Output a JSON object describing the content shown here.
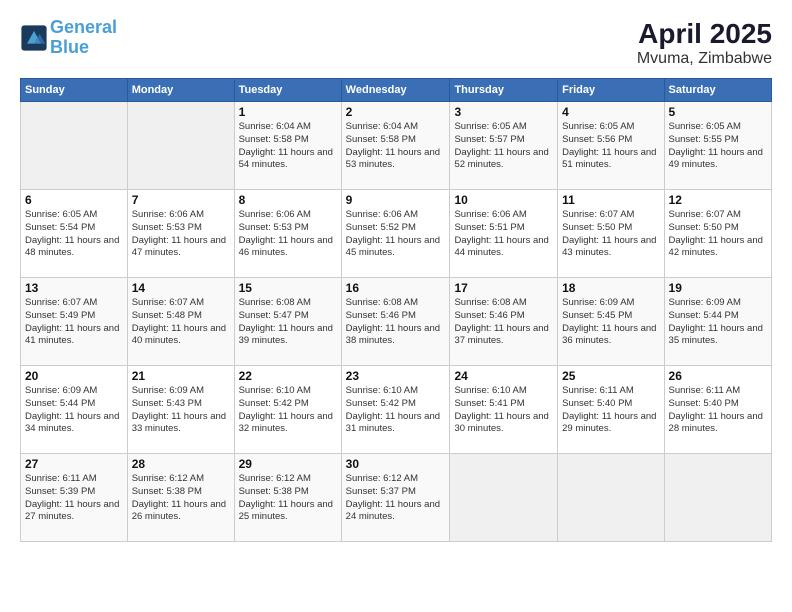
{
  "header": {
    "logo_line1": "General",
    "logo_line2": "Blue",
    "title": "April 2025",
    "subtitle": "Mvuma, Zimbabwe"
  },
  "weekdays": [
    "Sunday",
    "Monday",
    "Tuesday",
    "Wednesday",
    "Thursday",
    "Friday",
    "Saturday"
  ],
  "weeks": [
    [
      {
        "day": null,
        "sunrise": null,
        "sunset": null,
        "daylight": null
      },
      {
        "day": null,
        "sunrise": null,
        "sunset": null,
        "daylight": null
      },
      {
        "day": "1",
        "sunrise": "Sunrise: 6:04 AM",
        "sunset": "Sunset: 5:58 PM",
        "daylight": "Daylight: 11 hours and 54 minutes."
      },
      {
        "day": "2",
        "sunrise": "Sunrise: 6:04 AM",
        "sunset": "Sunset: 5:58 PM",
        "daylight": "Daylight: 11 hours and 53 minutes."
      },
      {
        "day": "3",
        "sunrise": "Sunrise: 6:05 AM",
        "sunset": "Sunset: 5:57 PM",
        "daylight": "Daylight: 11 hours and 52 minutes."
      },
      {
        "day": "4",
        "sunrise": "Sunrise: 6:05 AM",
        "sunset": "Sunset: 5:56 PM",
        "daylight": "Daylight: 11 hours and 51 minutes."
      },
      {
        "day": "5",
        "sunrise": "Sunrise: 6:05 AM",
        "sunset": "Sunset: 5:55 PM",
        "daylight": "Daylight: 11 hours and 49 minutes."
      }
    ],
    [
      {
        "day": "6",
        "sunrise": "Sunrise: 6:05 AM",
        "sunset": "Sunset: 5:54 PM",
        "daylight": "Daylight: 11 hours and 48 minutes."
      },
      {
        "day": "7",
        "sunrise": "Sunrise: 6:06 AM",
        "sunset": "Sunset: 5:53 PM",
        "daylight": "Daylight: 11 hours and 47 minutes."
      },
      {
        "day": "8",
        "sunrise": "Sunrise: 6:06 AM",
        "sunset": "Sunset: 5:53 PM",
        "daylight": "Daylight: 11 hours and 46 minutes."
      },
      {
        "day": "9",
        "sunrise": "Sunrise: 6:06 AM",
        "sunset": "Sunset: 5:52 PM",
        "daylight": "Daylight: 11 hours and 45 minutes."
      },
      {
        "day": "10",
        "sunrise": "Sunrise: 6:06 AM",
        "sunset": "Sunset: 5:51 PM",
        "daylight": "Daylight: 11 hours and 44 minutes."
      },
      {
        "day": "11",
        "sunrise": "Sunrise: 6:07 AM",
        "sunset": "Sunset: 5:50 PM",
        "daylight": "Daylight: 11 hours and 43 minutes."
      },
      {
        "day": "12",
        "sunrise": "Sunrise: 6:07 AM",
        "sunset": "Sunset: 5:50 PM",
        "daylight": "Daylight: 11 hours and 42 minutes."
      }
    ],
    [
      {
        "day": "13",
        "sunrise": "Sunrise: 6:07 AM",
        "sunset": "Sunset: 5:49 PM",
        "daylight": "Daylight: 11 hours and 41 minutes."
      },
      {
        "day": "14",
        "sunrise": "Sunrise: 6:07 AM",
        "sunset": "Sunset: 5:48 PM",
        "daylight": "Daylight: 11 hours and 40 minutes."
      },
      {
        "day": "15",
        "sunrise": "Sunrise: 6:08 AM",
        "sunset": "Sunset: 5:47 PM",
        "daylight": "Daylight: 11 hours and 39 minutes."
      },
      {
        "day": "16",
        "sunrise": "Sunrise: 6:08 AM",
        "sunset": "Sunset: 5:46 PM",
        "daylight": "Daylight: 11 hours and 38 minutes."
      },
      {
        "day": "17",
        "sunrise": "Sunrise: 6:08 AM",
        "sunset": "Sunset: 5:46 PM",
        "daylight": "Daylight: 11 hours and 37 minutes."
      },
      {
        "day": "18",
        "sunrise": "Sunrise: 6:09 AM",
        "sunset": "Sunset: 5:45 PM",
        "daylight": "Daylight: 11 hours and 36 minutes."
      },
      {
        "day": "19",
        "sunrise": "Sunrise: 6:09 AM",
        "sunset": "Sunset: 5:44 PM",
        "daylight": "Daylight: 11 hours and 35 minutes."
      }
    ],
    [
      {
        "day": "20",
        "sunrise": "Sunrise: 6:09 AM",
        "sunset": "Sunset: 5:44 PM",
        "daylight": "Daylight: 11 hours and 34 minutes."
      },
      {
        "day": "21",
        "sunrise": "Sunrise: 6:09 AM",
        "sunset": "Sunset: 5:43 PM",
        "daylight": "Daylight: 11 hours and 33 minutes."
      },
      {
        "day": "22",
        "sunrise": "Sunrise: 6:10 AM",
        "sunset": "Sunset: 5:42 PM",
        "daylight": "Daylight: 11 hours and 32 minutes."
      },
      {
        "day": "23",
        "sunrise": "Sunrise: 6:10 AM",
        "sunset": "Sunset: 5:42 PM",
        "daylight": "Daylight: 11 hours and 31 minutes."
      },
      {
        "day": "24",
        "sunrise": "Sunrise: 6:10 AM",
        "sunset": "Sunset: 5:41 PM",
        "daylight": "Daylight: 11 hours and 30 minutes."
      },
      {
        "day": "25",
        "sunrise": "Sunrise: 6:11 AM",
        "sunset": "Sunset: 5:40 PM",
        "daylight": "Daylight: 11 hours and 29 minutes."
      },
      {
        "day": "26",
        "sunrise": "Sunrise: 6:11 AM",
        "sunset": "Sunset: 5:40 PM",
        "daylight": "Daylight: 11 hours and 28 minutes."
      }
    ],
    [
      {
        "day": "27",
        "sunrise": "Sunrise: 6:11 AM",
        "sunset": "Sunset: 5:39 PM",
        "daylight": "Daylight: 11 hours and 27 minutes."
      },
      {
        "day": "28",
        "sunrise": "Sunrise: 6:12 AM",
        "sunset": "Sunset: 5:38 PM",
        "daylight": "Daylight: 11 hours and 26 minutes."
      },
      {
        "day": "29",
        "sunrise": "Sunrise: 6:12 AM",
        "sunset": "Sunset: 5:38 PM",
        "daylight": "Daylight: 11 hours and 25 minutes."
      },
      {
        "day": "30",
        "sunrise": "Sunrise: 6:12 AM",
        "sunset": "Sunset: 5:37 PM",
        "daylight": "Daylight: 11 hours and 24 minutes."
      },
      {
        "day": null,
        "sunrise": null,
        "sunset": null,
        "daylight": null
      },
      {
        "day": null,
        "sunrise": null,
        "sunset": null,
        "daylight": null
      },
      {
        "day": null,
        "sunrise": null,
        "sunset": null,
        "daylight": null
      }
    ]
  ]
}
